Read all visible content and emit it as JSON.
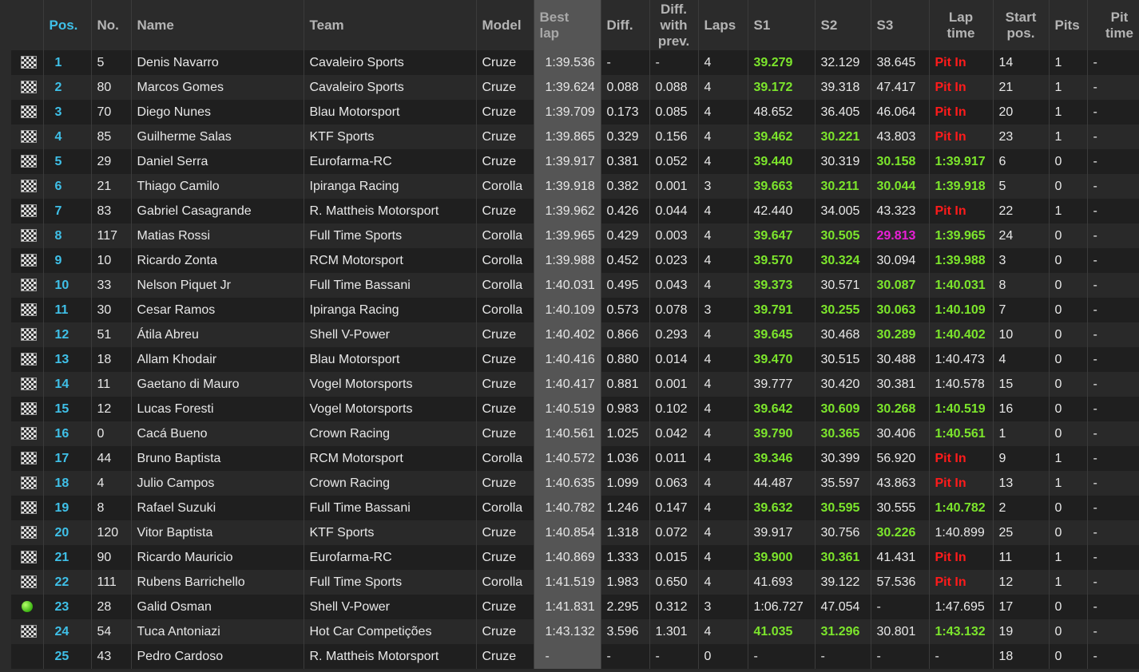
{
  "headers": {
    "pos": "Pos.",
    "no": "No.",
    "name": "Name",
    "team": "Team",
    "model": "Model",
    "best_l1": "Best",
    "best_l2": "lap",
    "diff": "Diff.",
    "diffp_l1": "Diff.",
    "diffp_l2": "with",
    "diffp_l3": "prev.",
    "laps": "Laps",
    "s1": "S1",
    "s2": "S2",
    "s3": "S3",
    "lap_l1": "Lap",
    "lap_l2": "time",
    "start_l1": "Start",
    "start_l2": "pos.",
    "pits": "Pits",
    "pitt_l1": "Pit",
    "pitt_l2": "time"
  },
  "colors": {
    "green": "#7ce52c",
    "purple": "#e81fd6",
    "red": "#ff1b1b",
    "pos": "#3fc0e8"
  },
  "rows": [
    {
      "flag": "checkered",
      "pos": "1",
      "no": "5",
      "name": "Denis Navarro",
      "team": "Cavaleiro Sports",
      "model": "Cruze",
      "best": "1:39.536",
      "diff": "-",
      "diffp": "-",
      "laps": "4",
      "s1": "39.279",
      "s1c": "green",
      "s2": "32.129",
      "s2c": "",
      "s3": "38.645",
      "s3c": "",
      "lap": "Pit In",
      "lapc": "red",
      "start": "14",
      "pits": "1",
      "pitt": "-"
    },
    {
      "flag": "checkered",
      "pos": "2",
      "no": "80",
      "name": "Marcos Gomes",
      "team": "Cavaleiro Sports",
      "model": "Cruze",
      "best": "1:39.624",
      "diff": "0.088",
      "diffp": "0.088",
      "laps": "4",
      "s1": "39.172",
      "s1c": "green",
      "s2": "39.318",
      "s2c": "",
      "s3": "47.417",
      "s3c": "",
      "lap": "Pit In",
      "lapc": "red",
      "start": "21",
      "pits": "1",
      "pitt": "-"
    },
    {
      "flag": "checkered",
      "pos": "3",
      "no": "70",
      "name": "Diego Nunes",
      "team": "Blau Motorsport",
      "model": "Cruze",
      "best": "1:39.709",
      "diff": "0.173",
      "diffp": "0.085",
      "laps": "4",
      "s1": "48.652",
      "s1c": "",
      "s2": "36.405",
      "s2c": "",
      "s3": "46.064",
      "s3c": "",
      "lap": "Pit In",
      "lapc": "red",
      "start": "20",
      "pits": "1",
      "pitt": "-"
    },
    {
      "flag": "checkered",
      "pos": "4",
      "no": "85",
      "name": "Guilherme Salas",
      "team": "KTF Sports",
      "model": "Cruze",
      "best": "1:39.865",
      "diff": "0.329",
      "diffp": "0.156",
      "laps": "4",
      "s1": "39.462",
      "s1c": "green",
      "s2": "30.221",
      "s2c": "green",
      "s3": "43.803",
      "s3c": "",
      "lap": "Pit In",
      "lapc": "red",
      "start": "23",
      "pits": "1",
      "pitt": "-"
    },
    {
      "flag": "checkered",
      "pos": "5",
      "no": "29",
      "name": "Daniel Serra",
      "team": "Eurofarma-RC",
      "model": "Cruze",
      "best": "1:39.917",
      "diff": "0.381",
      "diffp": "0.052",
      "laps": "4",
      "s1": "39.440",
      "s1c": "green",
      "s2": "30.319",
      "s2c": "",
      "s3": "30.158",
      "s3c": "green",
      "lap": "1:39.917",
      "lapc": "green",
      "start": "6",
      "pits": "0",
      "pitt": "-"
    },
    {
      "flag": "checkered",
      "pos": "6",
      "no": "21",
      "name": "Thiago Camilo",
      "team": "Ipiranga Racing",
      "model": "Corolla",
      "best": "1:39.918",
      "diff": "0.382",
      "diffp": "0.001",
      "laps": "3",
      "s1": "39.663",
      "s1c": "green",
      "s2": "30.211",
      "s2c": "green",
      "s3": "30.044",
      "s3c": "green",
      "lap": "1:39.918",
      "lapc": "green",
      "start": "5",
      "pits": "0",
      "pitt": "-"
    },
    {
      "flag": "checkered",
      "pos": "7",
      "no": "83",
      "name": "Gabriel Casagrande",
      "team": "R. Mattheis Motorsport",
      "model": "Cruze",
      "best": "1:39.962",
      "diff": "0.426",
      "diffp": "0.044",
      "laps": "4",
      "s1": "42.440",
      "s1c": "",
      "s2": "34.005",
      "s2c": "",
      "s3": "43.323",
      "s3c": "",
      "lap": "Pit In",
      "lapc": "red",
      "start": "22",
      "pits": "1",
      "pitt": "-"
    },
    {
      "flag": "checkered",
      "pos": "8",
      "no": "117",
      "name": "Matias Rossi",
      "team": "Full Time Sports",
      "model": "Corolla",
      "best": "1:39.965",
      "diff": "0.429",
      "diffp": "0.003",
      "laps": "4",
      "s1": "39.647",
      "s1c": "green",
      "s2": "30.505",
      "s2c": "green",
      "s3": "29.813",
      "s3c": "purple",
      "lap": "1:39.965",
      "lapc": "green",
      "start": "24",
      "pits": "0",
      "pitt": "-"
    },
    {
      "flag": "checkered",
      "pos": "9",
      "no": "10",
      "name": "Ricardo Zonta",
      "team": "RCM Motorsport",
      "model": "Corolla",
      "best": "1:39.988",
      "diff": "0.452",
      "diffp": "0.023",
      "laps": "4",
      "s1": "39.570",
      "s1c": "green",
      "s2": "30.324",
      "s2c": "green",
      "s3": "30.094",
      "s3c": "",
      "lap": "1:39.988",
      "lapc": "green",
      "start": "3",
      "pits": "0",
      "pitt": "-"
    },
    {
      "flag": "checkered",
      "pos": "10",
      "no": "33",
      "name": "Nelson Piquet Jr",
      "team": "Full Time Bassani",
      "model": "Corolla",
      "best": "1:40.031",
      "diff": "0.495",
      "diffp": "0.043",
      "laps": "4",
      "s1": "39.373",
      "s1c": "green",
      "s2": "30.571",
      "s2c": "",
      "s3": "30.087",
      "s3c": "green",
      "lap": "1:40.031",
      "lapc": "green",
      "start": "8",
      "pits": "0",
      "pitt": "-"
    },
    {
      "flag": "checkered",
      "pos": "11",
      "no": "30",
      "name": "Cesar Ramos",
      "team": "Ipiranga Racing",
      "model": "Corolla",
      "best": "1:40.109",
      "diff": "0.573",
      "diffp": "0.078",
      "laps": "3",
      "s1": "39.791",
      "s1c": "green",
      "s2": "30.255",
      "s2c": "green",
      "s3": "30.063",
      "s3c": "green",
      "lap": "1:40.109",
      "lapc": "green",
      "start": "7",
      "pits": "0",
      "pitt": "-"
    },
    {
      "flag": "checkered",
      "pos": "12",
      "no": "51",
      "name": "Átila Abreu",
      "team": "Shell V-Power",
      "model": "Cruze",
      "best": "1:40.402",
      "diff": "0.866",
      "diffp": "0.293",
      "laps": "4",
      "s1": "39.645",
      "s1c": "green",
      "s2": "30.468",
      "s2c": "",
      "s3": "30.289",
      "s3c": "green",
      "lap": "1:40.402",
      "lapc": "green",
      "start": "10",
      "pits": "0",
      "pitt": "-"
    },
    {
      "flag": "checkered",
      "pos": "13",
      "no": "18",
      "name": "Allam Khodair",
      "team": "Blau Motorsport",
      "model": "Cruze",
      "best": "1:40.416",
      "diff": "0.880",
      "diffp": "0.014",
      "laps": "4",
      "s1": "39.470",
      "s1c": "green",
      "s2": "30.515",
      "s2c": "",
      "s3": "30.488",
      "s3c": "",
      "lap": "1:40.473",
      "lapc": "",
      "start": "4",
      "pits": "0",
      "pitt": "-"
    },
    {
      "flag": "checkered",
      "pos": "14",
      "no": "11",
      "name": "Gaetano di Mauro",
      "team": "Vogel Motorsports",
      "model": "Cruze",
      "best": "1:40.417",
      "diff": "0.881",
      "diffp": "0.001",
      "laps": "4",
      "s1": "39.777",
      "s1c": "",
      "s2": "30.420",
      "s2c": "",
      "s3": "30.381",
      "s3c": "",
      "lap": "1:40.578",
      "lapc": "",
      "start": "15",
      "pits": "0",
      "pitt": "-"
    },
    {
      "flag": "checkered",
      "pos": "15",
      "no": "12",
      "name": "Lucas Foresti",
      "team": "Vogel Motorsports",
      "model": "Cruze",
      "best": "1:40.519",
      "diff": "0.983",
      "diffp": "0.102",
      "laps": "4",
      "s1": "39.642",
      "s1c": "green",
      "s2": "30.609",
      "s2c": "green",
      "s3": "30.268",
      "s3c": "green",
      "lap": "1:40.519",
      "lapc": "green",
      "start": "16",
      "pits": "0",
      "pitt": "-"
    },
    {
      "flag": "checkered",
      "pos": "16",
      "no": "0",
      "name": "Cacá Bueno",
      "team": "Crown Racing",
      "model": "Cruze",
      "best": "1:40.561",
      "diff": "1.025",
      "diffp": "0.042",
      "laps": "4",
      "s1": "39.790",
      "s1c": "green",
      "s2": "30.365",
      "s2c": "green",
      "s3": "30.406",
      "s3c": "",
      "lap": "1:40.561",
      "lapc": "green",
      "start": "1",
      "pits": "0",
      "pitt": "-"
    },
    {
      "flag": "checkered",
      "pos": "17",
      "no": "44",
      "name": "Bruno Baptista",
      "team": "RCM Motorsport",
      "model": "Corolla",
      "best": "1:40.572",
      "diff": "1.036",
      "diffp": "0.011",
      "laps": "4",
      "s1": "39.346",
      "s1c": "green",
      "s2": "30.399",
      "s2c": "",
      "s3": "56.920",
      "s3c": "",
      "lap": "Pit In",
      "lapc": "red",
      "start": "9",
      "pits": "1",
      "pitt": "-"
    },
    {
      "flag": "checkered",
      "pos": "18",
      "no": "4",
      "name": "Julio Campos",
      "team": "Crown Racing",
      "model": "Cruze",
      "best": "1:40.635",
      "diff": "1.099",
      "diffp": "0.063",
      "laps": "4",
      "s1": "44.487",
      "s1c": "",
      "s2": "35.597",
      "s2c": "",
      "s3": "43.863",
      "s3c": "",
      "lap": "Pit In",
      "lapc": "red",
      "start": "13",
      "pits": "1",
      "pitt": "-"
    },
    {
      "flag": "checkered",
      "pos": "19",
      "no": "8",
      "name": "Rafael Suzuki",
      "team": "Full Time Bassani",
      "model": "Corolla",
      "best": "1:40.782",
      "diff": "1.246",
      "diffp": "0.147",
      "laps": "4",
      "s1": "39.632",
      "s1c": "green",
      "s2": "30.595",
      "s2c": "green",
      "s3": "30.555",
      "s3c": "",
      "lap": "1:40.782",
      "lapc": "green",
      "start": "2",
      "pits": "0",
      "pitt": "-"
    },
    {
      "flag": "checkered",
      "pos": "20",
      "no": "120",
      "name": "Vitor Baptista",
      "team": "KTF Sports",
      "model": "Cruze",
      "best": "1:40.854",
      "diff": "1.318",
      "diffp": "0.072",
      "laps": "4",
      "s1": "39.917",
      "s1c": "",
      "s2": "30.756",
      "s2c": "",
      "s3": "30.226",
      "s3c": "green",
      "lap": "1:40.899",
      "lapc": "",
      "start": "25",
      "pits": "0",
      "pitt": "-"
    },
    {
      "flag": "checkered",
      "pos": "21",
      "no": "90",
      "name": "Ricardo Mauricio",
      "team": "Eurofarma-RC",
      "model": "Cruze",
      "best": "1:40.869",
      "diff": "1.333",
      "diffp": "0.015",
      "laps": "4",
      "s1": "39.900",
      "s1c": "green",
      "s2": "30.361",
      "s2c": "green",
      "s3": "41.431",
      "s3c": "",
      "lap": "Pit In",
      "lapc": "red",
      "start": "11",
      "pits": "1",
      "pitt": "-"
    },
    {
      "flag": "checkered",
      "pos": "22",
      "no": "111",
      "name": "Rubens Barrichello",
      "team": "Full Time Sports",
      "model": "Corolla",
      "best": "1:41.519",
      "diff": "1.983",
      "diffp": "0.650",
      "laps": "4",
      "s1": "41.693",
      "s1c": "",
      "s2": "39.122",
      "s2c": "",
      "s3": "57.536",
      "s3c": "",
      "lap": "Pit In",
      "lapc": "red",
      "start": "12",
      "pits": "1",
      "pitt": "-"
    },
    {
      "flag": "green-dot",
      "pos": "23",
      "no": "28",
      "name": "Galid Osman",
      "team": "Shell V-Power",
      "model": "Cruze",
      "best": "1:41.831",
      "diff": "2.295",
      "diffp": "0.312",
      "laps": "3",
      "s1": "1:06.727",
      "s1c": "",
      "s2": "47.054",
      "s2c": "",
      "s3": "-",
      "s3c": "",
      "lap": "1:47.695",
      "lapc": "",
      "start": "17",
      "pits": "0",
      "pitt": "-"
    },
    {
      "flag": "checkered",
      "pos": "24",
      "no": "54",
      "name": "Tuca Antoniazi",
      "team": "Hot Car Competições",
      "model": "Cruze",
      "best": "1:43.132",
      "diff": "3.596",
      "diffp": "1.301",
      "laps": "4",
      "s1": "41.035",
      "s1c": "green",
      "s2": "31.296",
      "s2c": "green",
      "s3": "30.801",
      "s3c": "",
      "lap": "1:43.132",
      "lapc": "green",
      "start": "19",
      "pits": "0",
      "pitt": "-"
    },
    {
      "flag": "none",
      "pos": "25",
      "no": "43",
      "name": "Pedro Cardoso",
      "team": "R. Mattheis Motorsport",
      "model": "Cruze",
      "best": "-",
      "diff": "-",
      "diffp": "-",
      "laps": "0",
      "s1": "-",
      "s1c": "",
      "s2": "-",
      "s2c": "",
      "s3": "-",
      "s3c": "",
      "lap": "-",
      "lapc": "",
      "start": "18",
      "pits": "0",
      "pitt": "-"
    }
  ]
}
